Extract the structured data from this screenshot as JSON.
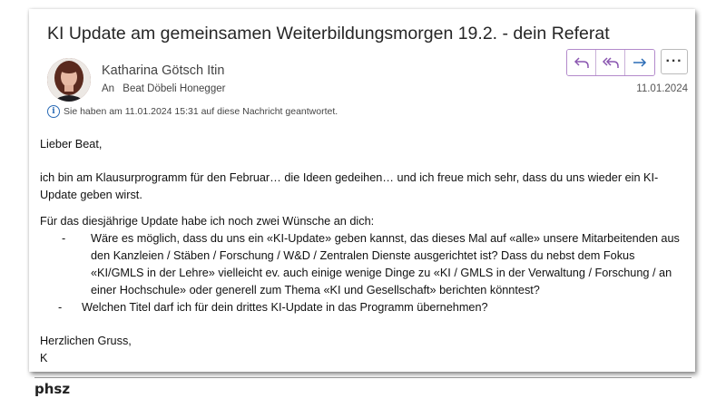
{
  "email": {
    "subject": "KI Update am gemeinsamen Weiterbildungsmorgen 19.2. - dein Referat",
    "sender": "Katharina Götsch Itin",
    "to_label": "An",
    "recipient": "Beat Döbeli Honegger",
    "date": "11.01.2024",
    "info": "Sie haben am 11.01.2024 15:31 auf diese Nachricht geantwortet.",
    "actions": {
      "reply_icon": "reply-icon",
      "reply_all_icon": "reply-all-icon",
      "forward_icon": "forward-icon",
      "more_label": "···"
    },
    "body": {
      "greeting": "Lieber Beat,",
      "para1": "ich bin am Klausurprogramm für den Februar… die Ideen gedeihen… und ich freue mich sehr, dass du uns wieder ein KI-Update geben wirst.",
      "para2": "Für das diesjährige Update habe ich noch zwei Wünsche an dich:",
      "bullet_marker": "-",
      "bullets": [
        "Wäre es möglich, dass du uns ein «KI-Update» geben kannst, das dieses Mal auf «alle» unsere Mitarbeitenden aus den Kanzleien / Stäben / Forschung / W&D / Zentralen Dienste ausgerichtet ist? Dass du nebst dem Fokus «KI/GMLS in der Lehre» vielleicht ev. auch einige wenige Dinge zu «KI / GMLS in der Verwaltung / Forschung / an einer Hochschule» oder generell zum Thema «KI und Gesellschaft» berichten könntest?",
        "Welchen Titel darf ich für dein drittes KI-Update in das Programm übernehmen?"
      ],
      "closing": "Herzlichen Gruss,",
      "signature": "K"
    }
  },
  "footer": {
    "brand": "phsz"
  },
  "colors": {
    "accent": "#8a56b0",
    "info": "#2a6bb5"
  }
}
